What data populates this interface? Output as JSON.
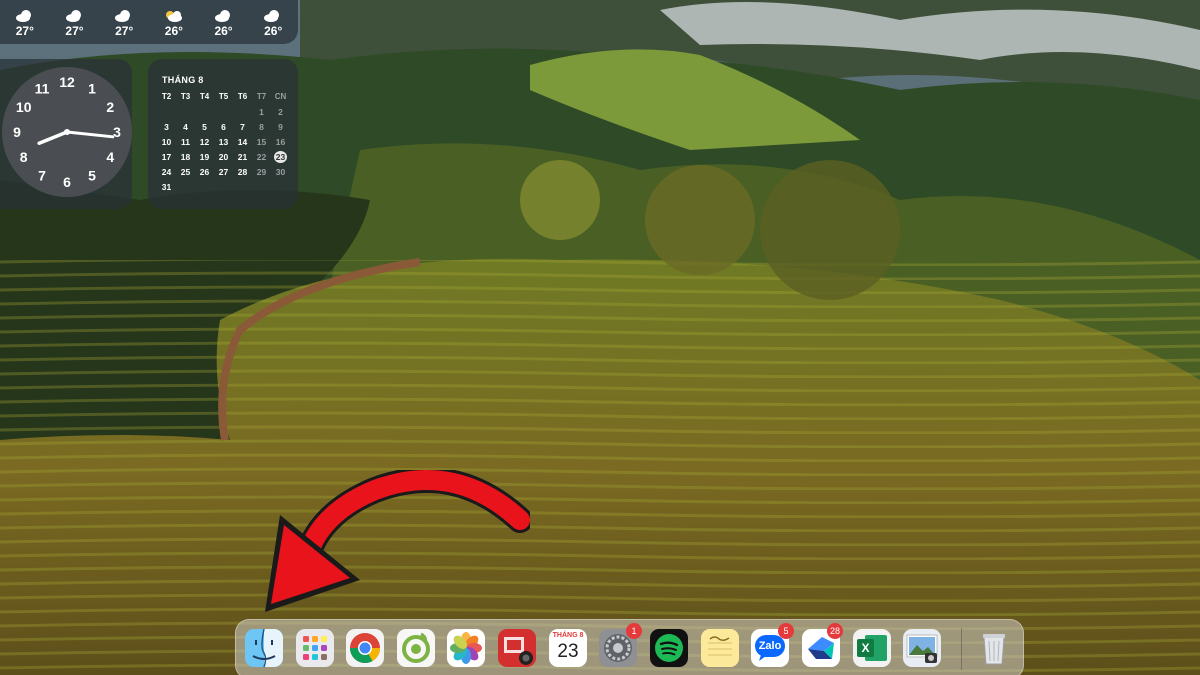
{
  "weather": {
    "items": [
      {
        "icon": "cloudy-icon",
        "temp": "27°"
      },
      {
        "icon": "cloudy-icon",
        "temp": "27°"
      },
      {
        "icon": "cloudy-icon",
        "temp": "27°"
      },
      {
        "icon": "partly-cloudy-icon",
        "temp": "26°"
      },
      {
        "icon": "cloudy-icon",
        "temp": "26°"
      },
      {
        "icon": "cloudy-icon",
        "temp": "26°"
      }
    ]
  },
  "clock": {
    "numbers": [
      "12",
      "1",
      "2",
      "3",
      "4",
      "5",
      "6",
      "7",
      "8",
      "9",
      "10",
      "11"
    ],
    "time": {
      "hour": 8,
      "minute": 16
    }
  },
  "calendar": {
    "month": "THÁNG 8",
    "weekdays": [
      "T2",
      "T3",
      "T4",
      "T5",
      "T6",
      "T7",
      "CN"
    ],
    "weeks": [
      [
        "",
        "",
        "",
        "",
        "",
        "1",
        "2"
      ],
      [
        "3",
        "4",
        "5",
        "6",
        "7",
        "8",
        "9"
      ],
      [
        "10",
        "11",
        "12",
        "13",
        "14",
        "15",
        "16"
      ],
      [
        "17",
        "18",
        "19",
        "20",
        "21",
        "22",
        "23"
      ],
      [
        "24",
        "25",
        "26",
        "27",
        "28",
        "29",
        "30"
      ],
      [
        "31",
        "",
        "",
        "",
        "",
        "",
        ""
      ]
    ],
    "today": "23"
  },
  "dock": {
    "apps": [
      {
        "name": "finder-icon"
      },
      {
        "name": "launchpad-icon"
      },
      {
        "name": "chrome-icon"
      },
      {
        "name": "coccoc-icon"
      },
      {
        "name": "photos-icon"
      },
      {
        "name": "photo-booth-icon"
      },
      {
        "name": "calendar-app-icon",
        "month": "THÁNG 8",
        "day": "23"
      },
      {
        "name": "system-settings-icon",
        "badge": "1"
      },
      {
        "name": "spotify-icon"
      },
      {
        "name": "notes-icon"
      },
      {
        "name": "zalo-icon",
        "label": "Zalo",
        "badge": "5"
      },
      {
        "name": "lark-icon",
        "badge": "28"
      },
      {
        "name": "excel-icon",
        "label": "X"
      },
      {
        "name": "preview-icon"
      },
      {
        "name": "trash-icon"
      }
    ]
  },
  "colors": {
    "arrow": "#e8131b",
    "badge": "#e5393b"
  }
}
